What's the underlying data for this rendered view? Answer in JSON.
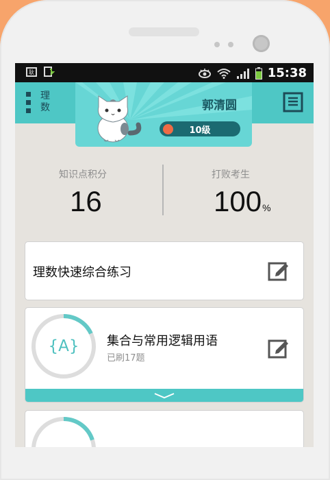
{
  "status_bar": {
    "time": "15:38",
    "icons": [
      "sim-icon",
      "download-icon",
      "eye-icon",
      "wifi-icon",
      "signal-icon",
      "battery-icon"
    ]
  },
  "header": {
    "menu_label": "理数",
    "user_name": "郭清圆",
    "level": "10级"
  },
  "stats": {
    "points_label": "知识点积分",
    "points_value": "16",
    "beat_label": "打败考生",
    "beat_value": "100",
    "beat_unit": "%"
  },
  "cards": {
    "quick_practice": "理数快速综合练习",
    "topic": {
      "title": "集合与常用逻辑用语",
      "subtitle": "已刷17题",
      "icon_text": "{A}",
      "progress": 0.18
    },
    "next_topic_progress": 0.2
  },
  "colors": {
    "accent": "#4ec7c5",
    "dark_teal": "#1b6a71",
    "knob": "#ef6b45",
    "background": "#f7a46b"
  }
}
